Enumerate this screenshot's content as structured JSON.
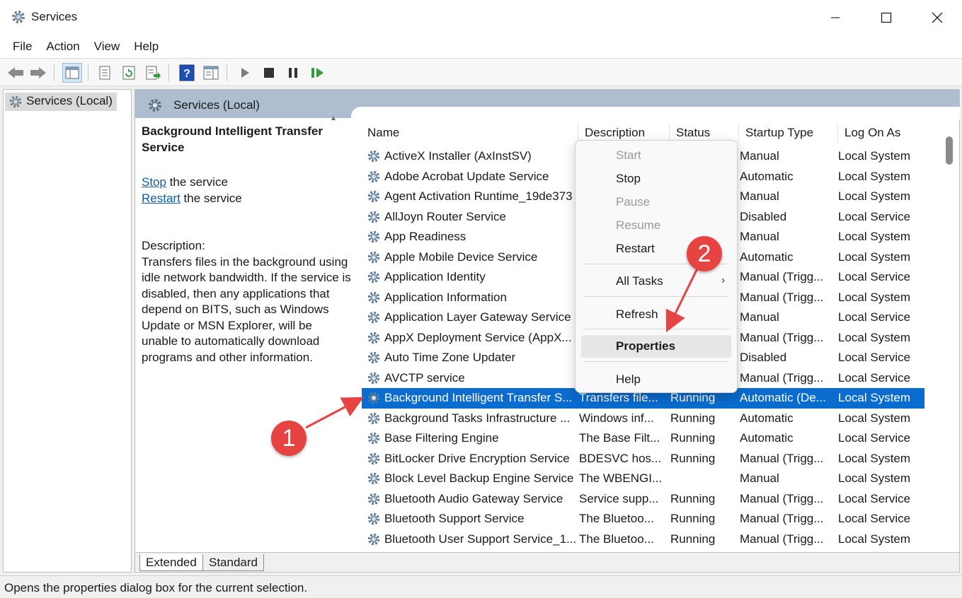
{
  "window": {
    "title": "Services"
  },
  "menu": [
    "File",
    "Action",
    "View",
    "Help"
  ],
  "tree": {
    "root_label": "Services (Local)"
  },
  "header": {
    "title": "Services (Local)"
  },
  "details": {
    "service_title": "Background Intelligent Transfer Service",
    "stop_link": "Stop",
    "stop_suffix": " the service",
    "restart_link": "Restart",
    "restart_suffix": " the service",
    "desc_label": "Description:",
    "desc_text": "Transfers files in the background using idle network bandwidth. If the service is disabled, then any applications that depend on BITS, such as Windows Update or MSN Explorer, will be unable to automatically download programs and other information."
  },
  "columns": {
    "name": "Name",
    "description": "Description",
    "status": "Status",
    "startup": "Startup Type",
    "logon": "Log On As"
  },
  "rows": [
    {
      "name": "ActiveX Installer (AxInstSV)",
      "description": "",
      "status": "",
      "startup": "Manual",
      "logon": "Local System"
    },
    {
      "name": "Adobe Acrobat Update Service",
      "description": "",
      "status": "",
      "startup": "Automatic",
      "logon": "Local System"
    },
    {
      "name": "Agent Activation Runtime_19de373",
      "description": "",
      "status": "",
      "startup": "Manual",
      "logon": "Local System"
    },
    {
      "name": "AllJoyn Router Service",
      "description": "",
      "status": "",
      "startup": "Disabled",
      "logon": "Local Service"
    },
    {
      "name": "App Readiness",
      "description": "",
      "status": "",
      "startup": "Manual",
      "logon": "Local System"
    },
    {
      "name": "Apple Mobile Device Service",
      "description": "",
      "status": "",
      "startup": "Automatic",
      "logon": "Local System"
    },
    {
      "name": "Application Identity",
      "description": "",
      "status": "",
      "startup": "Manual (Trigg...",
      "logon": "Local Service"
    },
    {
      "name": "Application Information",
      "description": "",
      "status": "",
      "startup": "Manual (Trigg...",
      "logon": "Local System"
    },
    {
      "name": "Application Layer Gateway Service",
      "description": "",
      "status": "",
      "startup": "Manual",
      "logon": "Local Service"
    },
    {
      "name": "AppX Deployment Service (AppX...",
      "description": "",
      "status": "",
      "startup": "Manual (Trigg...",
      "logon": "Local System"
    },
    {
      "name": "Auto Time Zone Updater",
      "description": "",
      "status": "",
      "startup": "Disabled",
      "logon": "Local Service"
    },
    {
      "name": "AVCTP service",
      "description": "",
      "status": "",
      "startup": "Manual (Trigg...",
      "logon": "Local Service"
    },
    {
      "name": "Background Intelligent Transfer S...",
      "description": "Transfers file...",
      "status": "Running",
      "startup": "Automatic (De...",
      "logon": "Local System",
      "selected": true
    },
    {
      "name": "Background Tasks Infrastructure ...",
      "description": "Windows inf...",
      "status": "Running",
      "startup": "Automatic",
      "logon": "Local System"
    },
    {
      "name": "Base Filtering Engine",
      "description": "The Base Filt...",
      "status": "Running",
      "startup": "Automatic",
      "logon": "Local Service"
    },
    {
      "name": "BitLocker Drive Encryption Service",
      "description": "BDESVC hos...",
      "status": "Running",
      "startup": "Manual (Trigg...",
      "logon": "Local System"
    },
    {
      "name": "Block Level Backup Engine Service",
      "description": "The WBENGI...",
      "status": "",
      "startup": "Manual",
      "logon": "Local System"
    },
    {
      "name": "Bluetooth Audio Gateway Service",
      "description": "Service supp...",
      "status": "Running",
      "startup": "Manual (Trigg...",
      "logon": "Local Service"
    },
    {
      "name": "Bluetooth Support Service",
      "description": "The Bluetoo...",
      "status": "Running",
      "startup": "Manual (Trigg...",
      "logon": "Local Service"
    },
    {
      "name": "Bluetooth User Support Service_1...",
      "description": "The Bluetoo...",
      "status": "Running",
      "startup": "Manual (Trigg...",
      "logon": "Local System"
    }
  ],
  "tabs": {
    "extended": "Extended",
    "standard": "Standard"
  },
  "status_bar": "Opens the properties dialog box for the current selection.",
  "context_menu": {
    "start": "Start",
    "stop": "Stop",
    "pause": "Pause",
    "resume": "Resume",
    "restart": "Restart",
    "all_tasks": "All Tasks",
    "refresh": "Refresh",
    "properties": "Properties",
    "help": "Help"
  },
  "annotations": {
    "step1": "1",
    "step2": "2"
  },
  "colors": {
    "selection": "#0a6ccf",
    "header_band": "#aebed0",
    "annotation": "#e64343",
    "link": "#0b5cad"
  }
}
